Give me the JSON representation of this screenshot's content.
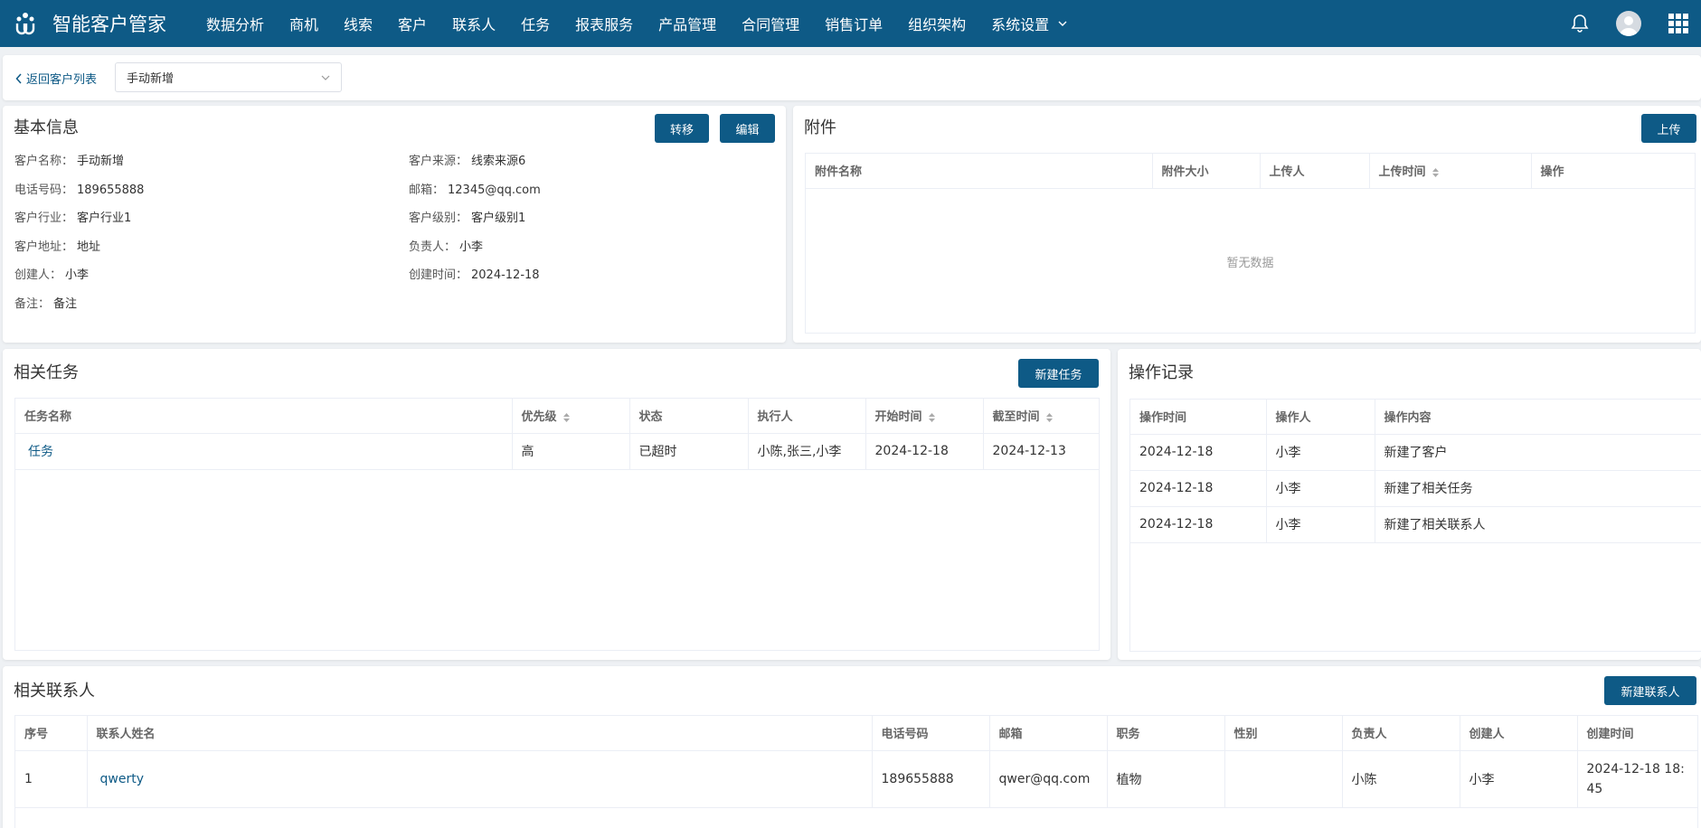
{
  "app": {
    "name": "智能客户管家"
  },
  "nav": {
    "items": [
      "数据分析",
      "商机",
      "线索",
      "客户",
      "联系人",
      "任务",
      "报表服务",
      "产品管理",
      "合同管理",
      "销售订单",
      "组织架构",
      "系统设置"
    ]
  },
  "subbar": {
    "back_label": "返回客户列表",
    "select_value": "手动新增"
  },
  "basic": {
    "title": "基本信息",
    "transfer_label": "转移",
    "edit_label": "编辑",
    "rows": [
      {
        "label": "客户名称：",
        "value": "手动新增"
      },
      {
        "label": "客户来源：",
        "value": "线索来源6"
      },
      {
        "label": "电话号码：",
        "value": "189655888"
      },
      {
        "label": "邮箱：",
        "value": "12345@qq.com"
      },
      {
        "label": "客户行业：",
        "value": "客户行业1"
      },
      {
        "label": "客户级别：",
        "value": "客户级别1"
      },
      {
        "label": "客户地址：",
        "value": "地址"
      },
      {
        "label": "负责人：",
        "value": "小李"
      },
      {
        "label": "创建人：",
        "value": "小李"
      },
      {
        "label": "创建时间：",
        "value": "2024-12-18"
      },
      {
        "label": "备注：",
        "value": "备注"
      }
    ]
  },
  "attachments": {
    "title": "附件",
    "upload_label": "上传",
    "columns": [
      "附件名称",
      "附件大小",
      "上传人",
      "上传时间",
      "操作"
    ],
    "empty_text": "暂无数据"
  },
  "tasks": {
    "title": "相关任务",
    "new_label": "新建任务",
    "columns": [
      "任务名称",
      "优先级",
      "状态",
      "执行人",
      "开始时间",
      "截至时间"
    ],
    "rows": [
      {
        "name": "任务",
        "priority": "高",
        "status": "已超时",
        "executor": "小陈,张三,小李",
        "start": "2024-12-18",
        "end": "2024-12-13"
      }
    ]
  },
  "logs": {
    "title": "操作记录",
    "columns": [
      "操作时间",
      "操作人",
      "操作内容"
    ],
    "rows": [
      {
        "time": "2024-12-18",
        "user": "小李",
        "content": "新建了客户"
      },
      {
        "time": "2024-12-18",
        "user": "小李",
        "content": "新建了相关任务"
      },
      {
        "time": "2024-12-18",
        "user": "小李",
        "content": "新建了相关联系人"
      }
    ]
  },
  "contacts": {
    "title": "相关联系人",
    "new_label": "新建联系人",
    "columns": [
      "序号",
      "联系人姓名",
      "电话号码",
      "邮箱",
      "职务",
      "性别",
      "负责人",
      "创建人",
      "创建时间"
    ],
    "rows": [
      {
        "index": "1",
        "name": "qwerty",
        "phone": "189655888",
        "email": "qwer@qq.com",
        "job": "植物",
        "gender": "",
        "owner": "小陈",
        "creator": "小李",
        "created_1": "2024-12-18 18:",
        "created_2": "45"
      }
    ]
  },
  "icons": {
    "logo": "app-logo-icon",
    "bell": "bell-icon",
    "avatar": "avatar-icon",
    "apps": "apps-grid-icon"
  },
  "colors": {
    "primary": "#0e5a86",
    "background": "#eef1f4"
  }
}
